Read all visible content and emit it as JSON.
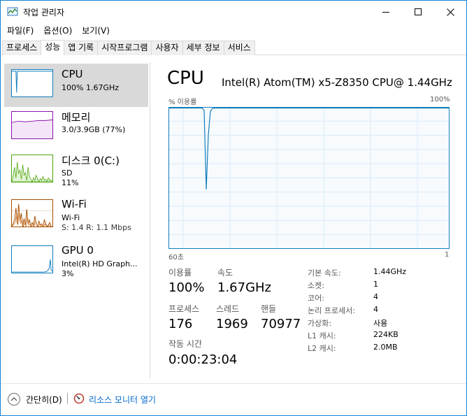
{
  "window": {
    "title": "작업 관리자"
  },
  "menu": [
    "파일(F)",
    "옵션(O)",
    "보기(V)"
  ],
  "tabs": [
    "프로세스",
    "성능",
    "앱 기록",
    "시작프로그램",
    "사용자",
    "세부 정보",
    "서비스"
  ],
  "active_tab": "성능",
  "sidebar": {
    "items": [
      {
        "title": "CPU",
        "sub1": "100% 1.67GHz",
        "sub2": "",
        "sub3": "",
        "color": "#117dbb"
      },
      {
        "title": "메모리",
        "sub1": "3.0/3.9GB (77%)",
        "sub2": "",
        "sub3": "",
        "color": "#8b12ae"
      },
      {
        "title": "디스크 0(C:)",
        "sub1": "SD",
        "sub2": "11%",
        "sub3": "",
        "color": "#4da60c"
      },
      {
        "title": "Wi-Fi",
        "sub1": "Wi-Fi",
        "sub2": "S: 1.4  R: 1.1 Mbps",
        "sub3": "",
        "color": "#a74f01"
      },
      {
        "title": "GPU 0",
        "sub1": "Intel(R) HD Graph...",
        "sub2": "3%",
        "sub3": "",
        "color": "#117dbb"
      }
    ]
  },
  "main": {
    "title": "CPU",
    "model": "Intel(R) Atom(TM) x5-Z8350 CPU@ 1.44GHz",
    "graph_label_left": "% 이용률",
    "graph_label_right": "100%",
    "graph_time_left": "60초",
    "graph_time_right": "1",
    "graph_color": "#117dbb"
  },
  "stats": {
    "usage_label": "이용률",
    "usage_value": "100%",
    "speed_label": "속도",
    "speed_value": "1.67GHz",
    "processes_label": "프로세스",
    "processes_value": "176",
    "threads_label": "스레드",
    "threads_value": "1969",
    "handles_label": "핸들",
    "handles_value": "70977",
    "uptime_label": "작동 시간",
    "uptime_value": "0:00:23:04"
  },
  "specs": [
    {
      "label": "기본 속도:",
      "value": "1.44GHz"
    },
    {
      "label": "소켓:",
      "value": "1"
    },
    {
      "label": "코어:",
      "value": "4"
    },
    {
      "label": "논리 프로세서:",
      "value": "4"
    },
    {
      "label": "가상화:",
      "value": "사용"
    },
    {
      "label": "L1 캐시:",
      "value": "224KB"
    },
    {
      "label": "L2 캐시:",
      "value": "2.0MB"
    }
  ],
  "footer": {
    "collapse_label": "간단히(D)",
    "monitor_label": "리소스 모니터 열기"
  }
}
